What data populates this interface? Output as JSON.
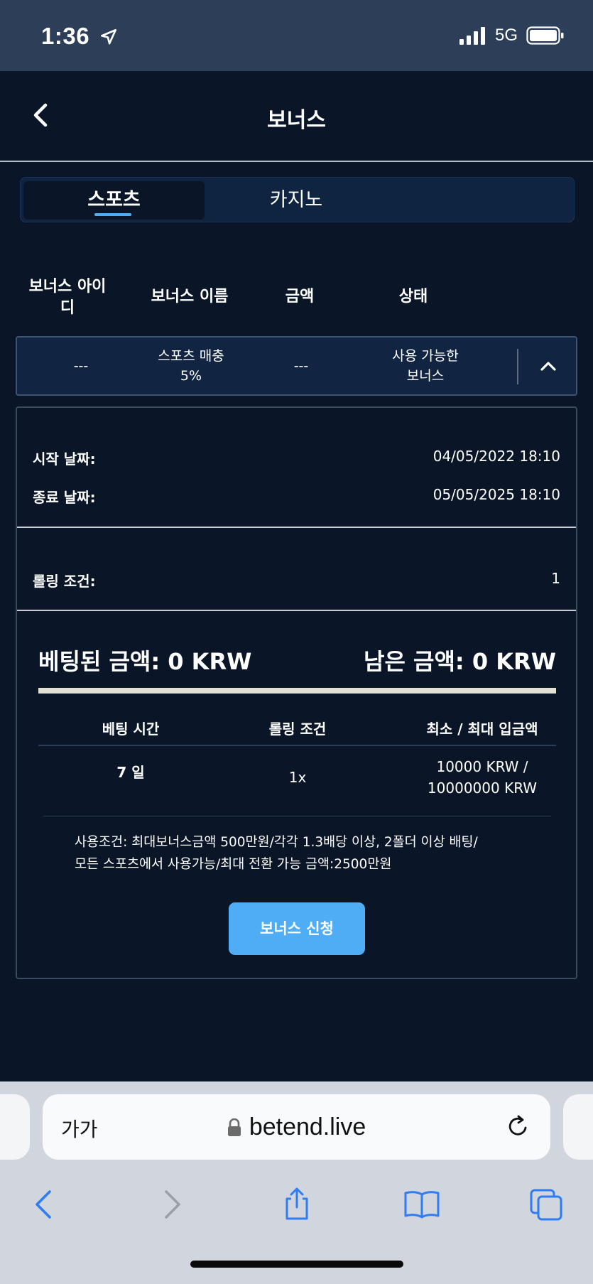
{
  "status_bar": {
    "time": "1:36",
    "network": "5G"
  },
  "header": {
    "title": "보너스"
  },
  "tabs": [
    {
      "label": "스포츠",
      "active": true
    },
    {
      "label": "카지노",
      "active": false
    }
  ],
  "table": {
    "headers": [
      "보너스 아이디",
      "보너스 이름",
      "금액",
      "상태"
    ],
    "row": {
      "id": "---",
      "name_line1": "스포츠 매충",
      "name_line2": "5%",
      "amount": "---",
      "status_line1": "사용 가능한",
      "status_line2": "보너스"
    }
  },
  "details": {
    "start_label": "시작 날짜:",
    "start_value": "04/05/2022 18:10",
    "end_label": "종료 날짜:",
    "end_value": "05/05/2025 18:10",
    "rolling_label": "롤링 조건:",
    "rolling_value": "1",
    "bet_amount": "베팅된 금액: 0 KRW",
    "remaining_amount": "남은 금액: 0 KRW",
    "progress_fraction": 0,
    "sub_headers": [
      "베팅 시간",
      "롤링 조건",
      "최소 / 최대 입금액"
    ],
    "bet_time": "7 일",
    "rolling_multiplier": "1x",
    "deposit_line1": "10000 KRW /",
    "deposit_line2": "10000000 KRW",
    "note_line1": "사용조건: 최대보너스금액 500만원/각각 1.3배당 이상, 2폴더 이상 배팅/",
    "note_line2": "모든 스포츠에서 사용가능/최대 전환 가능 금액:2500만원",
    "apply_label": "보너스 신청"
  },
  "browser": {
    "text_size_label": "가가",
    "url": "betend.live"
  },
  "colors": {
    "background": "#0a1628",
    "accent": "#4eadf5",
    "status_bar": "#2c3e58",
    "browser_chrome": "#d1d6de"
  },
  "icons": [
    "signal-icon",
    "battery-icon",
    "location-arrow-icon",
    "back-chevron-icon",
    "chevron-up-icon",
    "lock-icon",
    "reload-icon",
    "nav-back-icon",
    "nav-forward-icon",
    "share-icon",
    "bookmarks-icon",
    "tabs-icon"
  ]
}
